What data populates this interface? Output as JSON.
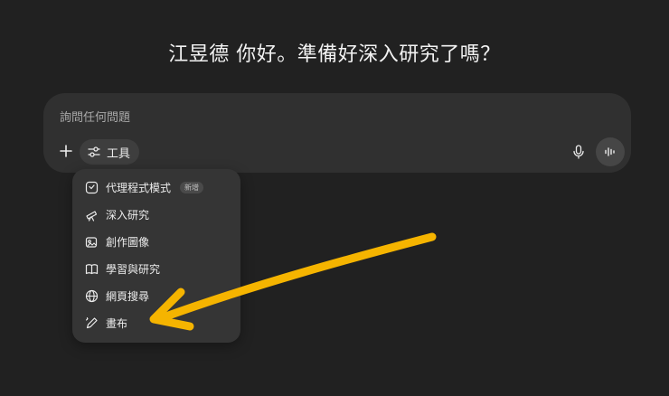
{
  "greeting": "江昱德 你好。準備好深入研究了嗎？",
  "composer": {
    "placeholder": "詢問任何問題",
    "tools_label": "工具"
  },
  "menu": {
    "items": [
      {
        "label": "代理程式模式",
        "badge": "新增",
        "icon": "agent-icon"
      },
      {
        "label": "深入研究",
        "icon": "telescope-icon"
      },
      {
        "label": "創作圖像",
        "icon": "image-create-icon"
      },
      {
        "label": "學習與研究",
        "icon": "book-icon"
      },
      {
        "label": "網頁搜尋",
        "icon": "globe-icon"
      },
      {
        "label": "畫布",
        "icon": "pencil-icon"
      }
    ]
  },
  "annotation": {
    "arrow_color": "#f5b400"
  }
}
